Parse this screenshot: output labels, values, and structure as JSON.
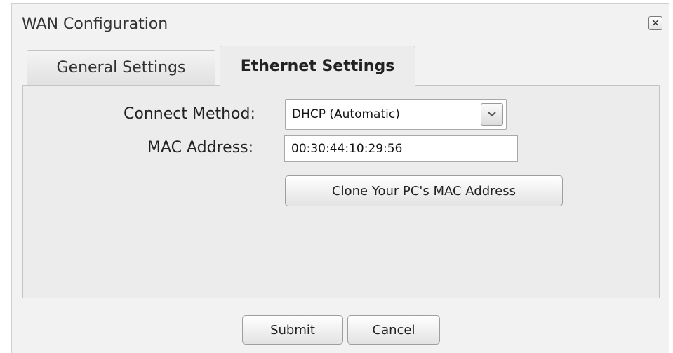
{
  "dialog": {
    "title": "WAN Configuration",
    "close_icon": "close-icon"
  },
  "tabs": [
    {
      "label": "General Settings",
      "active": false
    },
    {
      "label": "Ethernet Settings",
      "active": true
    }
  ],
  "form": {
    "connect_method_label": "Connect Method:",
    "connect_method_value": "DHCP (Automatic)",
    "mac_address_label": "MAC Address:",
    "mac_address_value": "00:30:44:10:29:56",
    "clone_button_label": "Clone Your PC's MAC Address"
  },
  "footer": {
    "submit_label": "Submit",
    "cancel_label": "Cancel"
  }
}
